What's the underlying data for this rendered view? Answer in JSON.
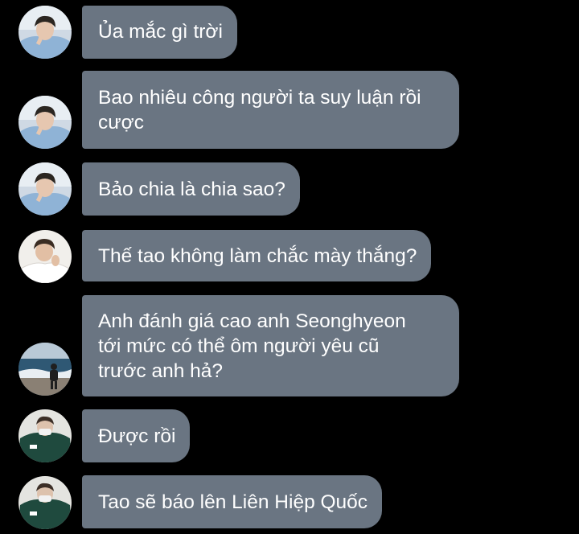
{
  "messages": [
    {
      "sender": "avatar-blue-hoodie",
      "text": "Ủa mắc gì trời"
    },
    {
      "sender": "avatar-blue-hoodie",
      "text": "Bao nhiêu công người ta suy luận rồi\ncược"
    },
    {
      "sender": "avatar-blue-hoodie",
      "text": "Bảo chia là chia sao?"
    },
    {
      "sender": "avatar-white-shirt",
      "text": "Thế tao không làm chắc mày thắng?"
    },
    {
      "sender": "avatar-beach",
      "text": "Anh đánh giá cao anh Seonghyeon\ntới mức có thể ôm người yêu cũ\ntrước anh hả?"
    },
    {
      "sender": "avatar-green-jacket",
      "text": "Được rồi"
    },
    {
      "sender": "avatar-green-jacket",
      "text": "Tao sẽ báo lên Liên Hiệp Quốc"
    }
  ],
  "colors": {
    "background": "#000000",
    "bubble": "#6a7582",
    "text": "#ffffff"
  }
}
